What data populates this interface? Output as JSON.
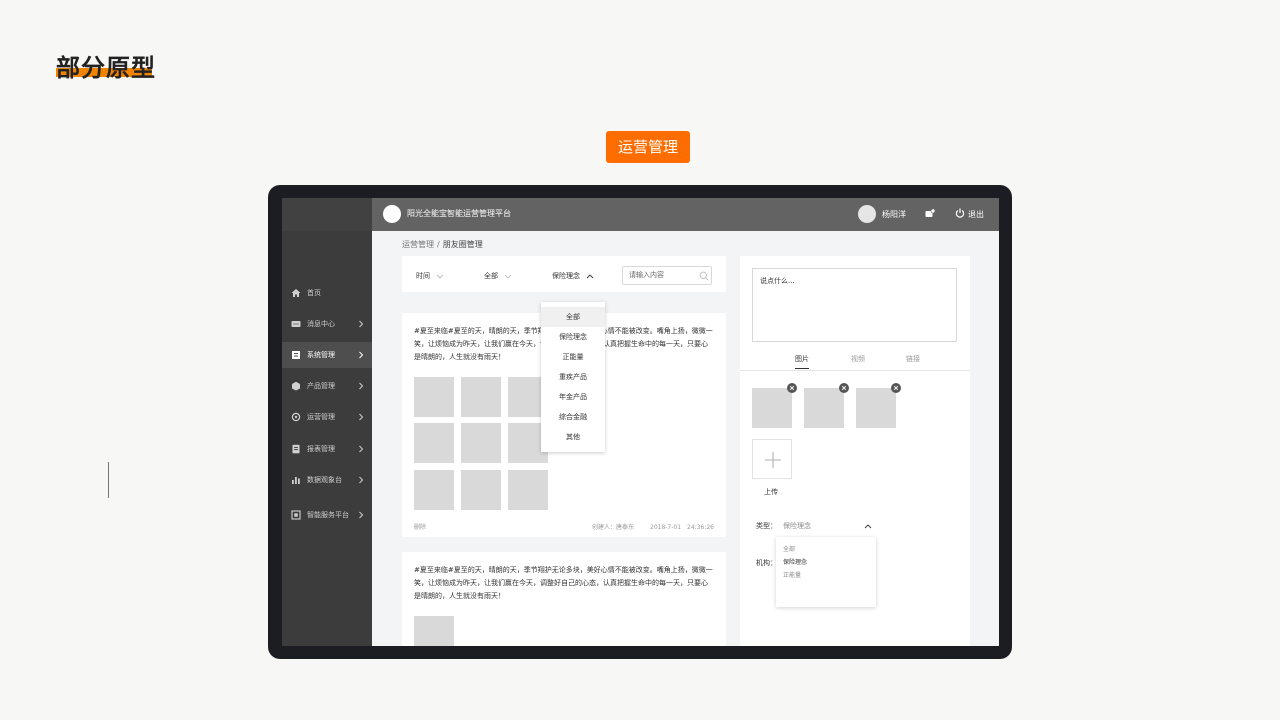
{
  "deco": {
    "title": "部分原型"
  },
  "section_badge": "运营管理",
  "app": {
    "title": "阳光全能宝智能运营管理平台",
    "user_name": "杨阳洋",
    "logout_label": "退出"
  },
  "sidebar": {
    "items": [
      {
        "label": "首页",
        "icon": "home-icon",
        "active": false
      },
      {
        "label": "消息中心",
        "icon": "message-icon",
        "active": false
      },
      {
        "label": "系统管理",
        "icon": "system-icon",
        "active": true
      },
      {
        "label": "产品管理",
        "icon": "product-icon",
        "active": false
      },
      {
        "label": "运营管理",
        "icon": "operation-icon",
        "active": false
      },
      {
        "label": "报表管理",
        "icon": "report-icon",
        "active": false
      },
      {
        "label": "数据观象台",
        "icon": "data-icon",
        "active": false
      },
      {
        "label": "智能服务平台",
        "icon": "service-icon",
        "active": false
      }
    ]
  },
  "breadcrumb": {
    "parent": "运营管理",
    "separator": "/",
    "current": "朋友圈管理"
  },
  "filters": {
    "time": "时间",
    "all": "全部",
    "category": "保险理念",
    "search_placeholder": "请输入内容"
  },
  "category_dropdown": {
    "options": [
      "全部",
      "保险理念",
      "正能量",
      "重疾产品",
      "年金产品",
      "综合金融",
      "其他"
    ],
    "selected_index": 0
  },
  "posts": [
    {
      "text": "#夏至来临#夏至的天，晴朗的天，季节翔护无论多块，美好心情不能被改变。嘴角上扬，微微一笑，让烦恼成为昨天，让我们赢在今天，调整好自己的心态，认真把握生命中的每一天，只要心是晴朗的，人生就没有雨天！",
      "delete_label": "删除",
      "creator": "创建人：唐泰东",
      "date": "2018-7-01　24:36:26",
      "image_count": 9
    },
    {
      "text": "#夏至来临#夏至的天，晴朗的天，季节翔护无论多块，美好心情不能被改变。嘴角上扬，微微一笑，让烦恼成为昨天，让我们赢在今天，调整好自己的心态，认真把握生命中的每一天，只要心是晴朗的，人生就没有雨天！",
      "image_count": 1
    }
  ],
  "composer": {
    "placeholder": "说点什么...",
    "tabs": [
      "图片",
      "视频",
      "链接"
    ],
    "active_tab_index": 0,
    "uploaded_count": 3,
    "upload_label": "上传",
    "type_label": "类型：",
    "type_value": "保险理念",
    "org_label": "机构：",
    "type_options": [
      "全部",
      "保险理念",
      "正能量"
    ],
    "type_selected_index": 1
  },
  "colors": {
    "accent": "#ff6d00",
    "deco_underline": "#f08300",
    "device_frame": "#1c1d22",
    "topbar": "#636363",
    "sidebar": "#3c3c3c",
    "sidebar_active": "#4e4e4e",
    "placeholder_image": "#d9d9d9"
  }
}
